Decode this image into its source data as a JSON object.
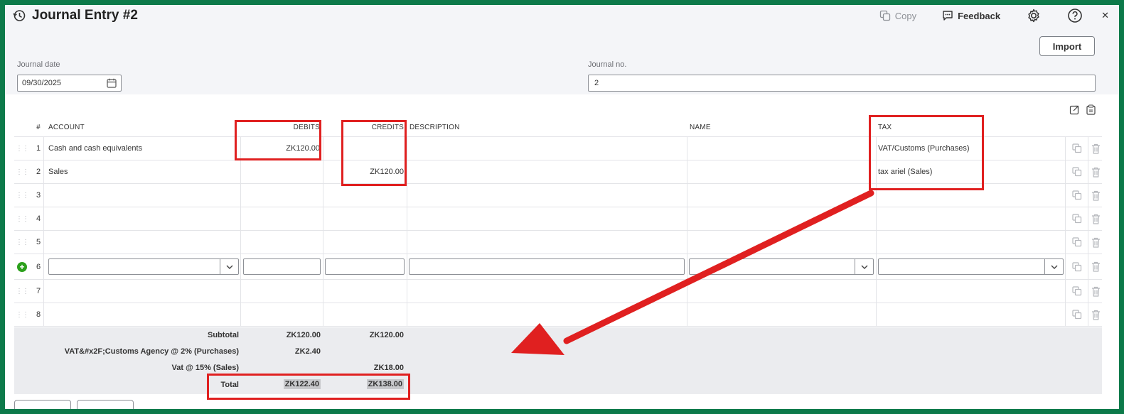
{
  "header": {
    "title": "Journal Entry #2",
    "copy_label": "Copy",
    "feedback_label": "Feedback"
  },
  "import_label": "Import",
  "journal_date": {
    "label": "Journal date",
    "value": "09/30/2025"
  },
  "journal_no": {
    "label": "Journal no.",
    "value": "2"
  },
  "columns": {
    "num": "#",
    "account": "ACCOUNT",
    "debits": "DEBITS",
    "credits": "CREDITS",
    "description": "DESCRIPTION",
    "name": "NAME",
    "tax": "TAX"
  },
  "rows": [
    {
      "num": "1",
      "account": "Cash and cash equivalents",
      "debits": "ZK120.00",
      "credits": "",
      "tax": "VAT/Customs (Purchases)"
    },
    {
      "num": "2",
      "account": "Sales",
      "debits": "",
      "credits": "ZK120.00",
      "tax": "tax ariel (Sales)"
    },
    {
      "num": "3"
    },
    {
      "num": "4"
    },
    {
      "num": "5"
    },
    {
      "num": "6"
    },
    {
      "num": "7"
    },
    {
      "num": "8"
    }
  ],
  "totals": {
    "subtotal_label": "Subtotal",
    "subtotal_debits": "ZK120.00",
    "subtotal_credits": "ZK120.00",
    "vat_customs_label": "VAT&#x2F;Customs Agency @ 2% (Purchases)",
    "vat_customs_debits": "ZK2.40",
    "vat15_label": "Vat @ 15% (Sales)",
    "vat15_credits": "ZK18.00",
    "total_label": "Total",
    "total_debits": "ZK122.40",
    "total_credits": "ZK138.00"
  },
  "colors": {
    "frame": "#0d7a4a",
    "annotation": "#e02020",
    "add_icon": "#2ca01c"
  }
}
